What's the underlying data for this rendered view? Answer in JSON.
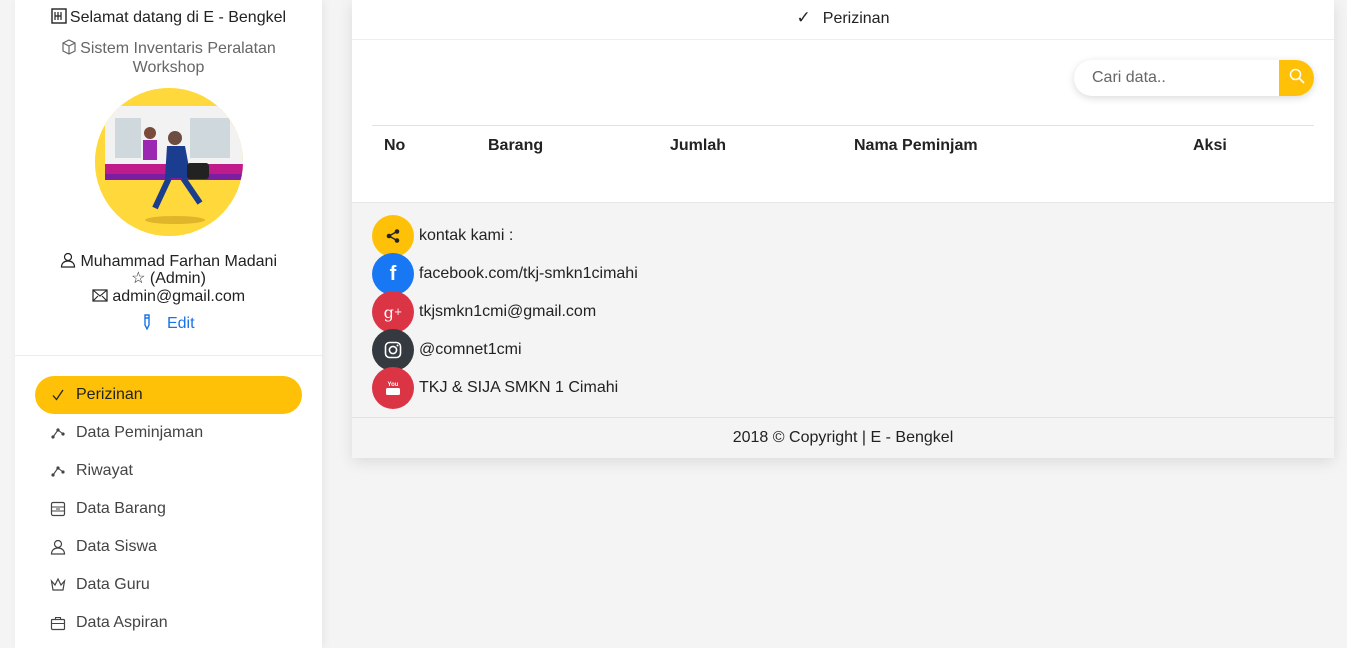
{
  "sidebar": {
    "welcome": "Selamat datang di E - Bengkel",
    "subtitle": "Sistem Inventaris Peralatan Workshop",
    "user": {
      "name": "Muhammad Farhan Madani",
      "role": "☆ (Admin)",
      "email": "admin@gmail.com",
      "edit_label": "Edit"
    },
    "menu": [
      {
        "label": "Perizinan",
        "icon": "check-icon",
        "active": true
      },
      {
        "label": "Data Peminjaman",
        "icon": "share-nodes-icon"
      },
      {
        "label": "Riwayat",
        "icon": "share-nodes-icon"
      },
      {
        "label": "Data Barang",
        "icon": "archive-icon"
      },
      {
        "label": "Data Siswa",
        "icon": "user-icon"
      },
      {
        "label": "Data Guru",
        "icon": "crown-icon"
      },
      {
        "label": "Data Aspiran",
        "icon": "briefcase-icon"
      }
    ]
  },
  "main": {
    "header_title": "Perizinan",
    "search": {
      "placeholder": "Cari data.."
    },
    "table_headers": [
      "No",
      "Barang",
      "Jumlah",
      "Nama Peminjam",
      "Aksi"
    ]
  },
  "contact": {
    "title": "kontak kami :",
    "facebook": "facebook.com/tkj-smkn1cimahi",
    "email": "tkjsmkn1cmi@gmail.com",
    "instagram": "@comnet1cmi",
    "youtube": "TKJ & SIJA SMKN 1 Cimahi"
  },
  "footer": {
    "copyright": "2018 © Copyright | E - Bengkel"
  },
  "colors": {
    "accent": "#ffc107",
    "facebook": "#1877f2",
    "google": "#db3545",
    "instagram": "#343a40",
    "youtube": "#db3545",
    "link": "#1a73e8"
  }
}
